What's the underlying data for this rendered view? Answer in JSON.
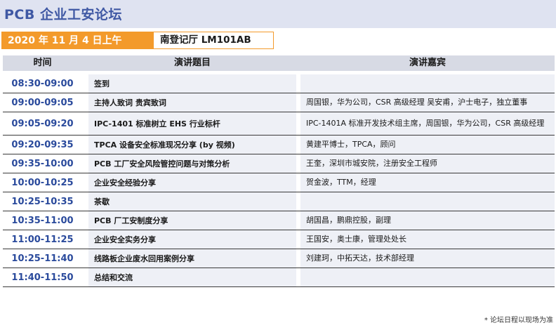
{
  "title": "PCB 企业工安论坛",
  "session": {
    "date": "2020 年 11 月 4 日上午",
    "room": "南登记厅 LM101AB"
  },
  "table": {
    "headers": {
      "time": "时间",
      "topic": "演讲题目",
      "speaker": "演讲嘉宾"
    },
    "rows": [
      {
        "time": "08:30-09:00",
        "topic": "签到",
        "speaker": ""
      },
      {
        "time": "09:00-09:05",
        "topic": "主持人致词 贵宾致词",
        "speaker": "周国银，华为公司，CSR 高级经理 吴安甫，沪士电子，独立董事"
      },
      {
        "time": "09:05-09:20",
        "topic": "IPC-1401 标准树立 EHS 行业标杆",
        "speaker": "IPC-1401A 标准开发技术组主席，周国银，华为公司，CSR 高级经理"
      },
      {
        "time": "09:20-09:35",
        "topic": "TPCA 设备安全标准现况分享 (by 视频)",
        "speaker": "黄建平博士，TPCA，顾问"
      },
      {
        "time": "09:35-10:00",
        "topic": "PCB 工厂安全风险管控问题与对策分析",
        "speaker": "王奎，深圳市城安院，注册安全工程师"
      },
      {
        "time": "10:00-10:25",
        "topic": "企业安全经验分享",
        "speaker": "贺金波，TTM，经理"
      },
      {
        "time": "10:25-10:35",
        "topic": "茶歇",
        "speaker": ""
      },
      {
        "time": "10:35-11:00",
        "topic": "PCB 厂工安制度分享",
        "speaker": "胡国昌，鹏鼎控股，副理"
      },
      {
        "time": "11:00-11:25",
        "topic": "企业安全实务分享",
        "speaker": "王国安，奥士康，管理处处长"
      },
      {
        "time": "10:25-11:40",
        "topic": "线路板企业废水回用案例分享",
        "speaker": "刘建珂，中拓天达，技术部经理"
      },
      {
        "time": "11:40-11:50",
        "topic": "总结和交流",
        "speaker": ""
      }
    ]
  },
  "footnote": "* 论坛日程以现场为准",
  "colors": {
    "title_text": "#3f58a4",
    "title_band": "#dfe3f1",
    "accent_orange": "#f39a2b",
    "time_text": "#2a4a9c",
    "header_band": "#d7dae4",
    "cell_fill": "#eef0f6"
  }
}
